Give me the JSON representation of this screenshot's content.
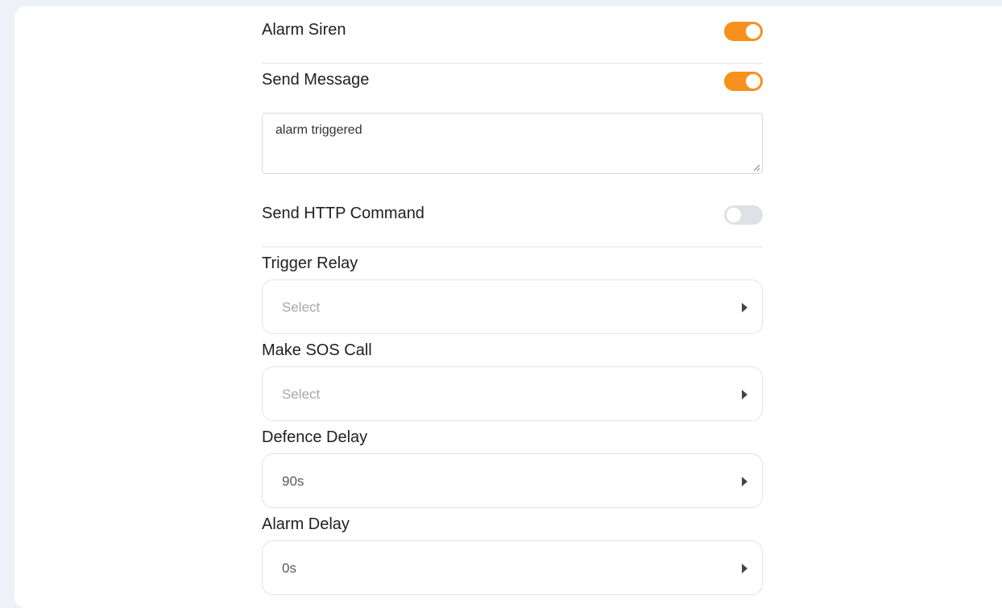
{
  "alarm_siren": {
    "label": "Alarm Siren",
    "enabled": true
  },
  "send_message": {
    "label": "Send Message",
    "enabled": true,
    "message_text": "alarm triggered"
  },
  "send_http": {
    "label": "Send HTTP Command",
    "enabled": false
  },
  "trigger_relay": {
    "label": "Trigger Relay",
    "value": "Select"
  },
  "sos_call": {
    "label": "Make SOS Call",
    "value": "Select"
  },
  "defence_delay": {
    "label": "Defence Delay",
    "value": "90s"
  },
  "alarm_delay": {
    "label": "Alarm Delay",
    "value": "0s"
  },
  "colors": {
    "accent": "#f6911e",
    "toggle_off": "#dfe1e6",
    "page_background": "#eef1f8"
  }
}
